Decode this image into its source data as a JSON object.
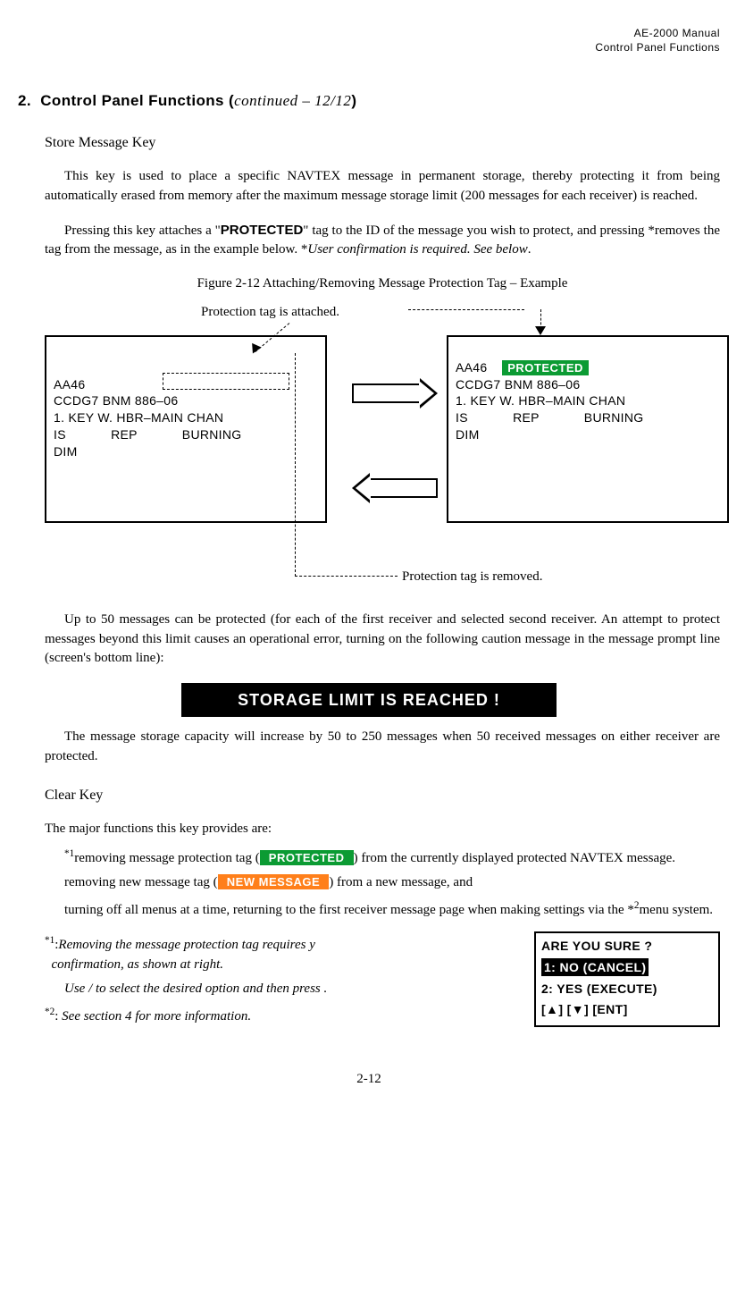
{
  "header": {
    "manual_title": "AE-2000 Manual",
    "chapter": "Control Panel Functions"
  },
  "section": {
    "number": "2.",
    "title": "Control Panel Functions",
    "continued": "continued – 12/12"
  },
  "store_key": {
    "heading": "Store Message Key",
    "p1": "This key is used to place a specific NAVTEX message in permanent storage, thereby protecting it from being automatically erased from memory after the maximum message storage limit (200 messages for each receiver) is reached.",
    "p2_a": "Pressing this key attaches a \"",
    "p2_protected": "PROTECTED",
    "p2_b": "\" tag to the ID of the message you wish to protect, and pressing       *removes the tag from the message, as in the example below. *",
    "p2_c": "User confirmation is required. See      below",
    "p2_d": "."
  },
  "figure": {
    "caption": "Figure 2-12   Attaching/Removing Message Protection Tag – Example",
    "attached_label": "Protection tag is attached.",
    "removed_label": "Protection tag is removed.",
    "screen_left": {
      "l1": "AA46",
      "l2": "CCDG7 BNM 886–06",
      "l3": "1. KEY W. HBR–MAIN CHAN",
      "l4": "IS            REP            BURNING",
      "l5": "DIM"
    },
    "screen_right": {
      "l1a": "AA46    ",
      "l1b": "PROTECTED",
      "l2": "CCDG7 BNM 886–06",
      "l3": "1. KEY W. HBR–MAIN CHAN",
      "l4": "IS            REP            BURNING",
      "l5": "DIM"
    }
  },
  "limit": {
    "p1": "Up to 50 messages can be protected (for each of the first receiver and selected second receiver. An attempt to protect messages beyond this limit causes an operational error, turning on the following caution message in the message prompt line (screen's bottom line):",
    "warning": "STORAGE LIMIT IS REACHED !",
    "p2": "The message storage capacity will increase by 50 to 250 messages when 50 received messages on either receiver are protected."
  },
  "clear_key": {
    "heading": "Clear Key",
    "intro": "The major functions this key provides are:",
    "f1_a": "removing message protection tag (",
    "f1_tag": " PROTECTED ",
    "f1_b": ") from the currently displayed protected NAVTEX message.",
    "f2_a": "removing new message tag (",
    "f2_tag": " NEW MESSAGE ",
    "f2_b": ") from a new message, and",
    "f3": "turning off all menus at a time, returning to the first receiver message page when making settings via the *",
    "f3_b": "menu system."
  },
  "notes": {
    "n1_a": "Removing   the   message   protection   tag   requires   y",
    "n1_b": "confirmation, as shown at right.",
    "n1_c": "Use       /       to select the desired option and then press       .",
    "n2": "See section 4 for more information",
    "sup1": "*1",
    "sup2": "*2"
  },
  "confirm": {
    "q": "ARE YOU SURE ?",
    "opt1": "1: NO (CANCEL)",
    "opt2": "2: YES (EXECUTE)",
    "keys": "[▲] [▼] [ENT]"
  },
  "page_number": "2-12"
}
